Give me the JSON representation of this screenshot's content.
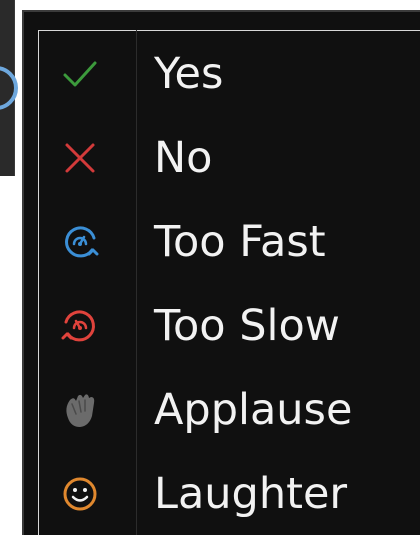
{
  "menu": {
    "items": [
      {
        "label": "Yes",
        "icon": "checkmark-icon",
        "color": "#3c9a3c"
      },
      {
        "label": "No",
        "icon": "close-icon",
        "color": "#d23a3a"
      },
      {
        "label": "Too Fast",
        "icon": "speed-up-icon",
        "color": "#3b8fd6"
      },
      {
        "label": "Too Slow",
        "icon": "slow-down-icon",
        "color": "#e0433c"
      },
      {
        "label": "Applause",
        "icon": "clapping-hands-icon",
        "color": "#6b6b6b"
      },
      {
        "label": "Laughter",
        "icon": "smiley-face-icon",
        "color": "#e0882e"
      }
    ]
  }
}
